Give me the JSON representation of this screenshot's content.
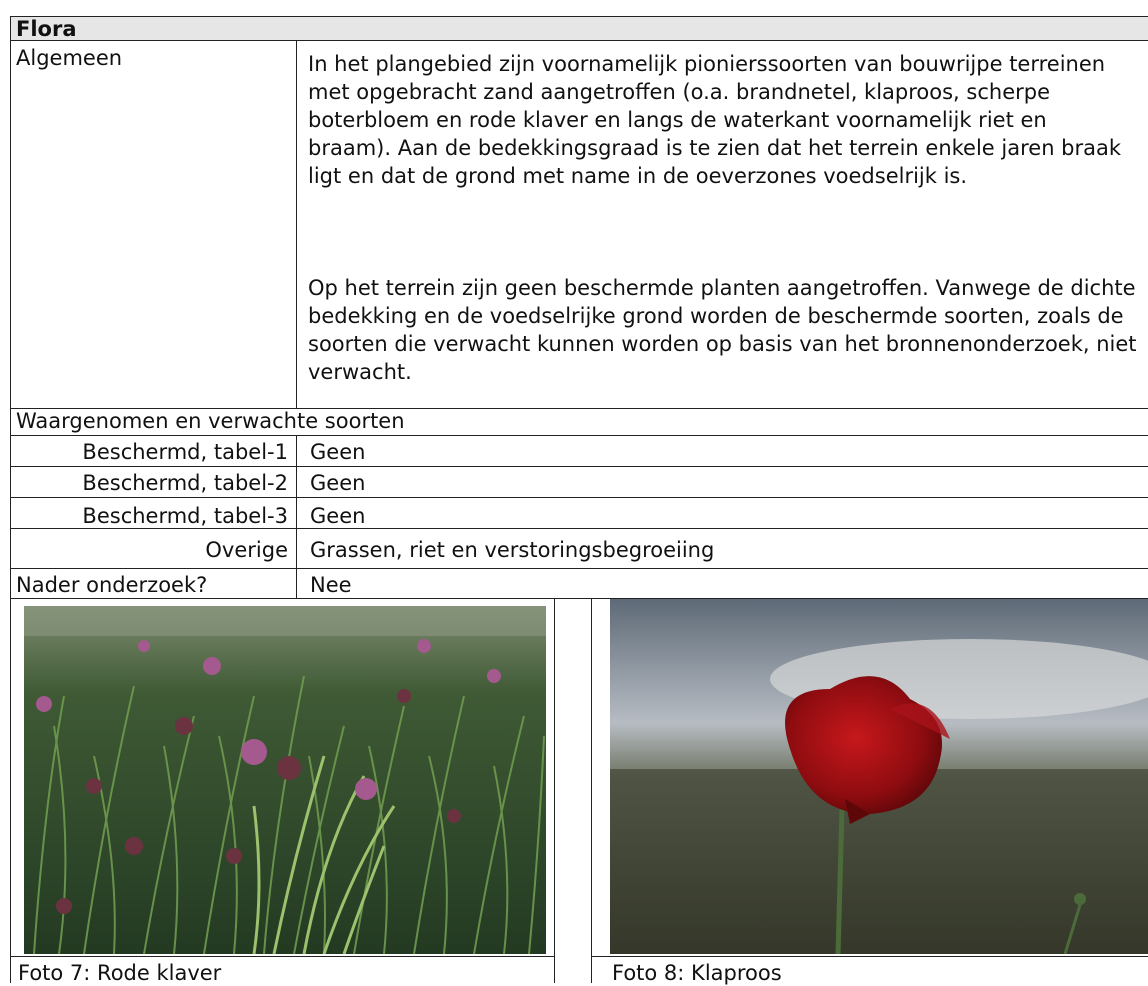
{
  "section_title": "Flora",
  "algemeen": {
    "label": "Algemeen",
    "paragraph1": "In het plangebied zijn voornamelijk pionierssoorten van bouwrijpe terreinen met opgebracht zand aangetroffen (o.a. brandnetel, klaproos, scherpe boterbloem en rode klaver en langs de waterkant voornamelijk riet en braam). Aan de bedekkingsgraad is te zien dat het terrein enkele jaren braak ligt en dat de grond met name in de oeverzones voedselrijk is.",
    "paragraph2": "Op het terrein zijn geen beschermde planten aangetroffen. Vanwege de dichte bedekking en de voedselrijke grond worden de beschermde soorten, zoals de soorten die verwacht kunnen worden op basis van het bronnenonderzoek, niet verwacht."
  },
  "observed_header": "Waargenomen en verwachte soorten",
  "rows": [
    {
      "label": "Beschermd, tabel-1",
      "value": "Geen"
    },
    {
      "label": "Beschermd, tabel-2",
      "value": "Geen"
    },
    {
      "label": "Beschermd, tabel-3",
      "value": "Geen"
    },
    {
      "label": "Overige",
      "value": "Grassen, riet en verstoringsbegroeiing"
    }
  ],
  "nader": {
    "label": "Nader onderzoek?",
    "value": "Nee"
  },
  "photos": [
    {
      "caption": "Foto 7: Rode klaver"
    },
    {
      "caption": "Foto 8: Klaproos"
    }
  ]
}
